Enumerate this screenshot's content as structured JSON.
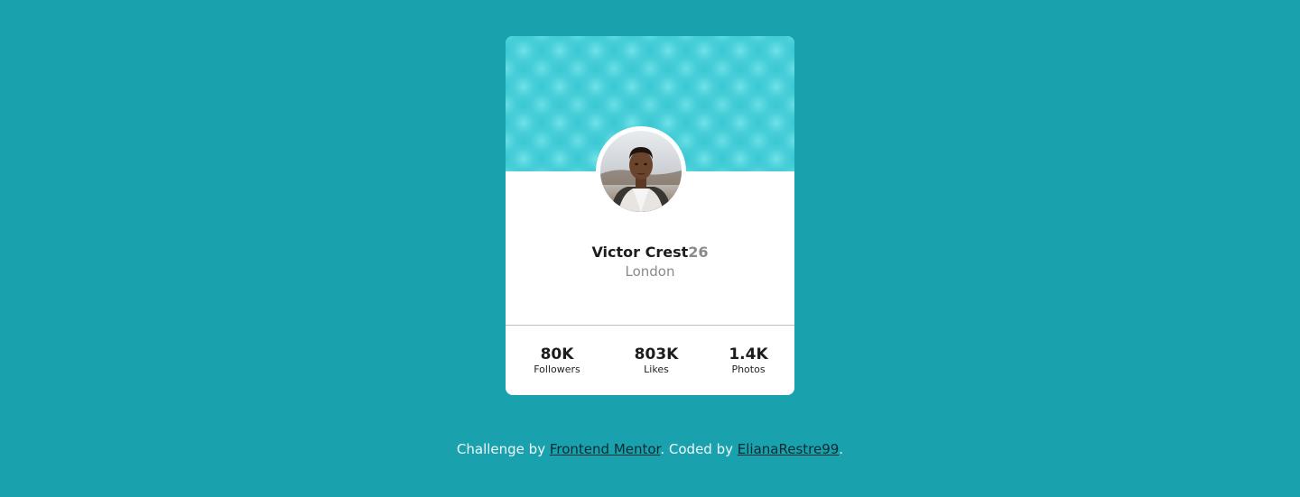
{
  "colors": {
    "background": "#19a2ae",
    "banner": "#3cc9d4",
    "card": "#ffffff",
    "muted_text": "#8a8a8a",
    "dark_text": "#1d1d1d",
    "link": "#0d2a30"
  },
  "profile": {
    "name": "Victor Crest",
    "age": "26",
    "city": "London",
    "avatar_icon": "profile-photo"
  },
  "stats": [
    {
      "value": "80K",
      "label": "Followers"
    },
    {
      "value": "803K",
      "label": "Likes"
    },
    {
      "value": "1.4K",
      "label": "Photos"
    }
  ],
  "attribution": {
    "prefix": "Challenge by ",
    "link1": "Frontend Mentor",
    "middle": ". Coded by ",
    "link2": "ElianaRestre99",
    "suffix": "."
  }
}
